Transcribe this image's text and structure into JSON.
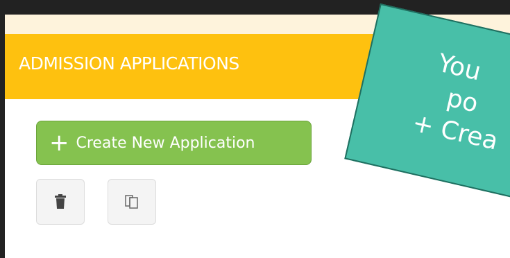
{
  "header": {
    "title": "ADMISSION APPLICATIONS"
  },
  "actions": {
    "create_icon": "+",
    "create_label": "Create New Application",
    "delete_icon": "trash-icon",
    "copy_icon": "copy-icon"
  },
  "callout": {
    "line1": "You",
    "line2": "po",
    "line3": "+ Crea"
  },
  "colors": {
    "header": "#fec10f",
    "button": "#85c24f",
    "callout": "#48bfa8"
  }
}
